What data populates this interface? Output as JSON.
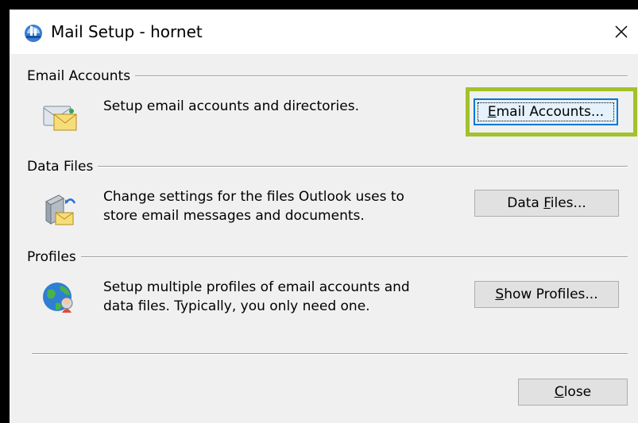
{
  "window": {
    "title": "Mail Setup - hornet",
    "icon": "mail-setup-icon",
    "close_glyph": "✕"
  },
  "sections": [
    {
      "header": "Email Accounts",
      "icon": "email-envelope-icon",
      "description": "Setup email accounts and directories.",
      "button": {
        "pre": "",
        "accel": "E",
        "post": "mail Accounts..."
      }
    },
    {
      "header": "Data Files",
      "icon": "data-files-icon",
      "description": "Change settings for the files Outlook uses to\nstore email messages and documents.",
      "button": {
        "pre": "Data ",
        "accel": "F",
        "post": "iles..."
      }
    },
    {
      "header": "Profiles",
      "icon": "profiles-globe-icon",
      "description": "Setup multiple profiles of email accounts and\ndata files. Typically, you only need one.",
      "button": {
        "pre": "",
        "accel": "S",
        "post": "how Profiles..."
      }
    }
  ],
  "footer": {
    "close_button": {
      "pre": "",
      "accel": "C",
      "post": "lose"
    }
  },
  "colors": {
    "highlight": "#a3c12b",
    "dialog_bg": "#f0f0f0",
    "titlebar_bg": "#ffffff"
  }
}
